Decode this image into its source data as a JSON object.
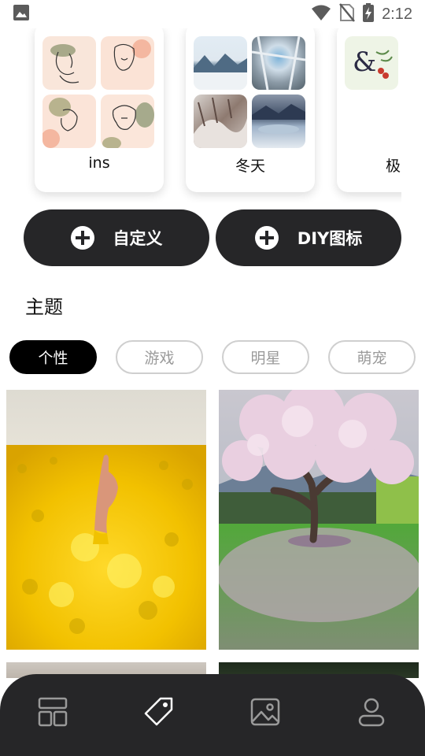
{
  "status_bar": {
    "time": "2:12",
    "icons": [
      "image-icon",
      "wifi-icon",
      "no-sim-icon",
      "battery-charging-icon"
    ]
  },
  "icon_categories": [
    {
      "label": "ins"
    },
    {
      "label": "冬天"
    },
    {
      "label": "极"
    }
  ],
  "actions": {
    "custom_label": "自定义",
    "diy_label": "DIY图标"
  },
  "themes": {
    "title": "主题",
    "chips": [
      {
        "label": "个性",
        "active": true
      },
      {
        "label": "游戏",
        "active": false
      },
      {
        "label": "明星",
        "active": false
      },
      {
        "label": "萌宠",
        "active": false
      }
    ]
  },
  "bottom_nav": {
    "items": [
      "layout-icon",
      "tag-icon",
      "gallery-icon",
      "profile-icon"
    ],
    "active_index": 1
  },
  "colors": {
    "dark": "#262628",
    "chip_border": "#cfcfcf",
    "chip_text": "#9a9a9a"
  }
}
